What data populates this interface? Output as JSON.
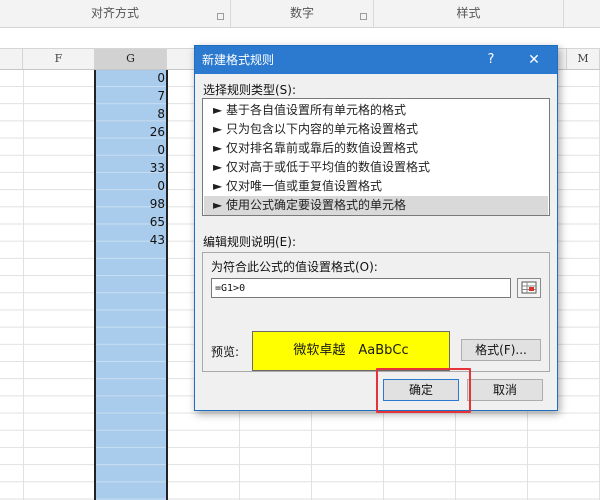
{
  "ribbon": {
    "groups": [
      {
        "label": "对齐方式"
      },
      {
        "label": "数字"
      },
      {
        "label": "样式"
      }
    ]
  },
  "sheet": {
    "columns": [
      "F",
      "G",
      "M"
    ],
    "selected_column": "G",
    "column_g_values": [
      "0",
      "7",
      "8",
      "26",
      "0",
      "33",
      "0",
      "98",
      "65",
      "43"
    ],
    "selection_color": "#a9ccec"
  },
  "dialog": {
    "title": "新建格式规则",
    "help_label": "?",
    "close_label": "✕",
    "rule_type_label": "选择规则类型(S):",
    "rule_types": [
      "► 基于各自值设置所有单元格的格式",
      "► 只为包含以下内容的单元格设置格式",
      "► 仅对排名靠前或靠后的数值设置格式",
      "► 仅对高于或低于平均值的数值设置格式",
      "► 仅对唯一值或重复值设置格式",
      "► 使用公式确定要设置格式的单元格"
    ],
    "active_rule_index": 5,
    "edit_desc_label": "编辑规则说明(E):",
    "formula_label": "为符合此公式的值设置格式(O):",
    "formula_value": "=G1>0",
    "preview_label": "预览:",
    "preview_text": "微软卓越　AaBbCc",
    "preview_color": "#ffff00",
    "format_button": "格式(F)...",
    "ok_button": "确定",
    "cancel_button": "取消",
    "title_bar_color": "#2b7ad0",
    "highlight_color": "#e8323a"
  }
}
